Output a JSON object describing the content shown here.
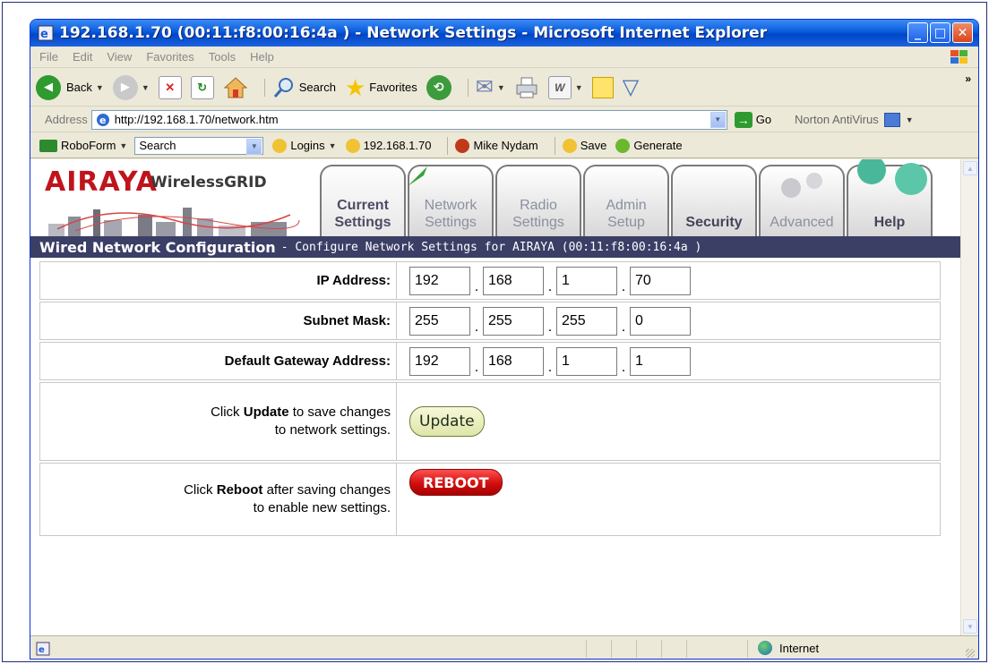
{
  "window": {
    "title": "192.168.1.70 (00:11:f8:00:16:4a ) - Network Settings - Microsoft Internet Explorer",
    "min_glyph": "_",
    "max_glyph": "□",
    "close_glyph": "✕"
  },
  "menubar": [
    "File",
    "Edit",
    "View",
    "Favorites",
    "Tools",
    "Help"
  ],
  "toolbar": {
    "back": "Back",
    "search": "Search",
    "favorites": "Favorites",
    "more": "»"
  },
  "addressbar": {
    "label": "Address",
    "url": "http://192.168.1.70/network.htm",
    "go": "Go",
    "norton": "Norton AntiVirus"
  },
  "roboform": {
    "name": "RoboForm",
    "search_value": "Search",
    "logins": "Logins",
    "ip_bookmark": "192.168.1.70",
    "user": "Mike Nydam",
    "save": "Save",
    "generate": "Generate"
  },
  "header": {
    "logo": "AIRAYA",
    "product": "WirelessGRID",
    "tabs": [
      {
        "line1": "Current",
        "line2": "Settings"
      },
      {
        "line1": "Network",
        "line2": "Settings"
      },
      {
        "line1": "Radio",
        "line2": "Settings"
      },
      {
        "line1": "Admin",
        "line2": "Setup"
      },
      {
        "line1": "",
        "line2": "Security"
      },
      {
        "line1": "",
        "line2": "Advanced"
      },
      {
        "line1": "",
        "line2": "Help"
      }
    ]
  },
  "section": {
    "title": "Wired Network Configuration",
    "subtitle": "- Configure Network Settings for AIRAYA (00:11:f8:00:16:4a )"
  },
  "form": {
    "ip": {
      "label": "IP Address:",
      "octets": [
        "192",
        "168",
        "1",
        "70"
      ]
    },
    "subnet": {
      "label": "Subnet Mask:",
      "octets": [
        "255",
        "255",
        "255",
        "0"
      ]
    },
    "gateway": {
      "label": "Default Gateway Address:",
      "octets": [
        "192",
        "168",
        "1",
        "1"
      ]
    },
    "update": {
      "text_pre": "Click ",
      "text_bold": "Update",
      "text_post": " to save changes",
      "text_line2": "to network settings.",
      "button": "Update"
    },
    "reboot": {
      "text_pre": "Click ",
      "text_bold": "Reboot",
      "text_post": " after saving changes",
      "text_line2": "to enable new settings.",
      "button": "REBOOT"
    },
    "dot": "."
  },
  "statusbar": {
    "zone": "Internet"
  },
  "colors": {
    "titlebar": "#0a5bdc",
    "section_bg": "#3b3f66",
    "logo_red": "#c0141c",
    "reboot_red": "#d00e0e"
  }
}
